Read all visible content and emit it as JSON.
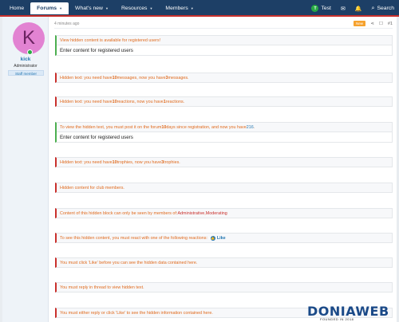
{
  "nav": {
    "home": "Home",
    "forums": "Forums",
    "whats_new": "What's new",
    "resources": "Resources",
    "members": "Members",
    "user": "Test",
    "user_initial": "T",
    "search": "Search"
  },
  "user": {
    "avatar_letter": "K",
    "name": "kick",
    "title": "Administrator",
    "badge": "Staff member"
  },
  "post": {
    "time": "4 minutes ago",
    "new_label": "New",
    "number": "#1"
  },
  "boxes": [
    {
      "kind": "ok",
      "title": "View hidden content is available for registered users!",
      "content": "Enter content for registered users"
    },
    {
      "kind": "locked",
      "t1": "Hidden text: you need have ",
      "n1": "10",
      "t2": " messages, now you have ",
      "n2": "3",
      "t3": " messages."
    },
    {
      "kind": "locked",
      "t1": "Hidden text: you need have ",
      "n1": "10",
      "t2": " reactions, now you have ",
      "n2": "1",
      "t3": " reactions."
    },
    {
      "kind": "ok",
      "t1": "To view the hidden text, you must post it on the forum ",
      "n1": "10",
      "t2": " days since registration, and now you have ",
      "n2": "216",
      "t3": ".",
      "content": "Enter content for registered users"
    },
    {
      "kind": "locked",
      "t1": "Hidden text: you need have ",
      "n1": "10",
      "t2": " trophies, now you have ",
      "n2": "3",
      "t3": " trophies."
    },
    {
      "kind": "locked",
      "title": "Hidden content for club members."
    },
    {
      "kind": "locked",
      "t1": "Content of this hidden block can only be seen by members of: ",
      "g1": "Administrative",
      "sep": ", ",
      "g2": "Moderating"
    },
    {
      "kind": "locked",
      "t1": "To see this hidden content, you must react with one of the following reactions: ",
      "reaction": "Like"
    },
    {
      "kind": "locked",
      "title": "You must click 'Like' before you can see the hidden data contained here."
    },
    {
      "kind": "locked",
      "title": "You must reply in thread to view hidden text."
    },
    {
      "kind": "locked",
      "title": "You must either reply or click 'Like' to see the hidden information contained here."
    }
  ],
  "logo": {
    "name": "DONIAWEB",
    "tagline": "FOUNDED IN 2018"
  },
  "colors": {
    "header": "#1d3f66",
    "accent_red": "#c9302c",
    "notice_text": "#e06a1d",
    "link_blue": "#2577b1",
    "ok_green": "#4caf50"
  }
}
